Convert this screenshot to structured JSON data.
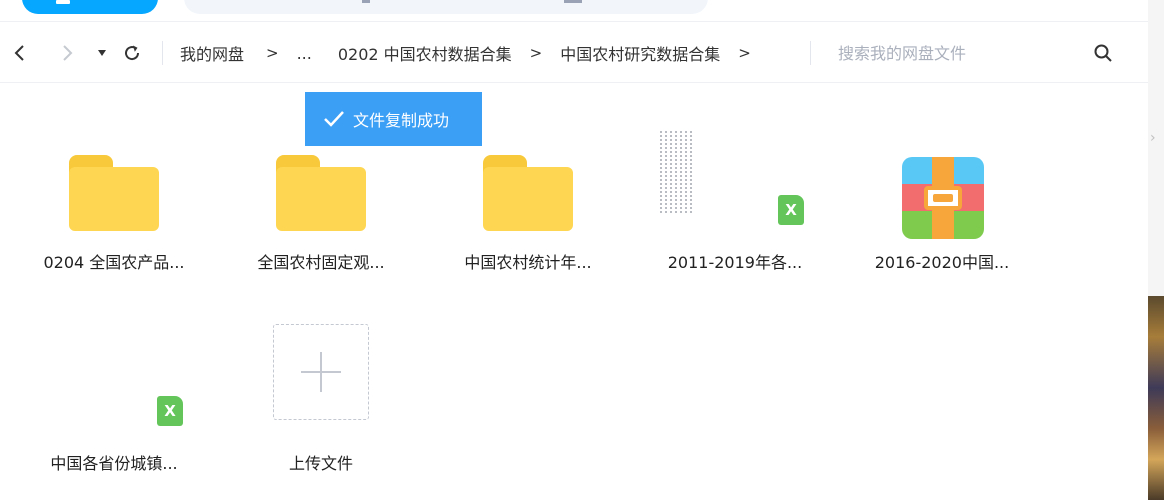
{
  "nav": {
    "breadcrumb": [
      {
        "label": "我的网盘"
      },
      {
        "label": "..."
      },
      {
        "label": "0202 中国农村数据合集"
      },
      {
        "label": "中国农村研究数据合集"
      }
    ],
    "sep": ">",
    "search_placeholder": "搜索我的网盘文件"
  },
  "toast": {
    "message": "文件复制成功"
  },
  "files": [
    {
      "name": "0204 全国农产品...",
      "type": "folder"
    },
    {
      "name": "全国农村固定观...",
      "type": "folder"
    },
    {
      "name": "中国农村统计年...",
      "type": "folder"
    },
    {
      "name": "2011-2019年各...",
      "type": "xls"
    },
    {
      "name": "2016-2020中国...",
      "type": "zip"
    },
    {
      "name": "中国各省份城镇...",
      "type": "xls"
    }
  ],
  "upload": {
    "label": "上传文件"
  },
  "xls_badge_glyph": "X",
  "colors": {
    "accent": "#06a7ff",
    "toast": "#3b9ff6",
    "folder": "#fed651",
    "xls": "#64c55b"
  }
}
